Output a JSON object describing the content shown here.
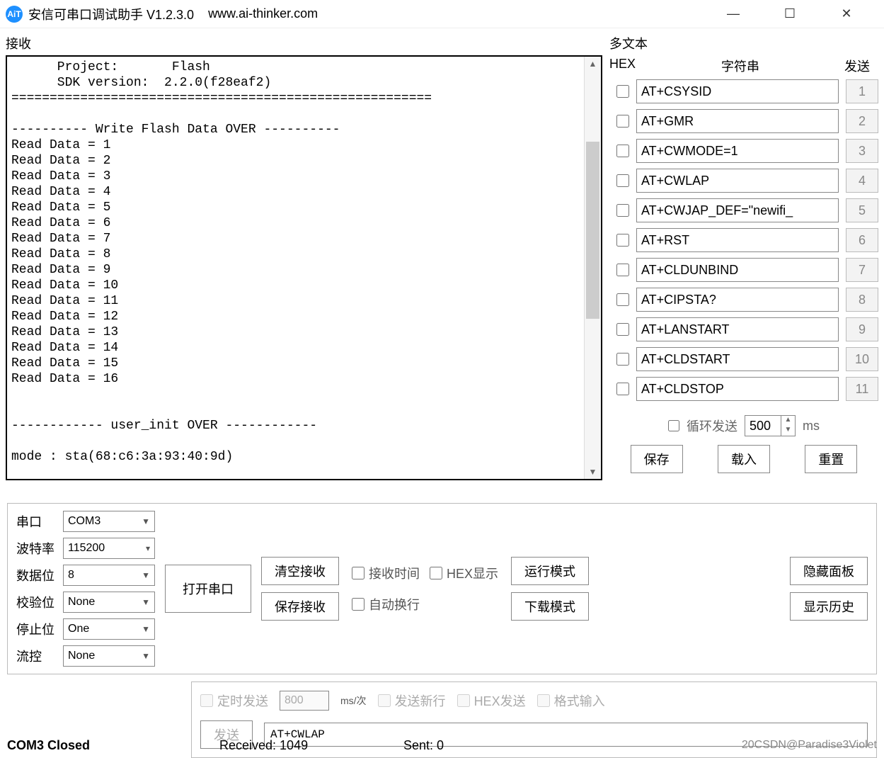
{
  "title_bar": {
    "app_icon_text": "AiT",
    "title": "安信可串口调试助手 V1.2.3.0",
    "url": "www.ai-thinker.com"
  },
  "receive": {
    "label": "接收",
    "content": "      Project:       Flash\n      SDK version:  2.2.0(f28eaf2)\n=======================================================\n\n---------- Write Flash Data OVER ----------\nRead Data = 1\nRead Data = 2\nRead Data = 3\nRead Data = 4\nRead Data = 5\nRead Data = 6\nRead Data = 7\nRead Data = 8\nRead Data = 9\nRead Data = 10\nRead Data = 11\nRead Data = 12\nRead Data = 13\nRead Data = 14\nRead Data = 15\nRead Data = 16\n\n\n------------ user_init OVER ------------\n\nmode : sta(68:c6:3a:93:40:9d)"
  },
  "multi": {
    "label": "多文本",
    "header_hex": "HEX",
    "header_str": "字符串",
    "header_send": "发送",
    "rows": [
      {
        "cmd": "AT+CSYSID",
        "num": "1"
      },
      {
        "cmd": "AT+GMR",
        "num": "2"
      },
      {
        "cmd": "AT+CWMODE=1",
        "num": "3"
      },
      {
        "cmd": "AT+CWLAP",
        "num": "4"
      },
      {
        "cmd": "AT+CWJAP_DEF=\"newifi_",
        "num": "5"
      },
      {
        "cmd": "AT+RST",
        "num": "6"
      },
      {
        "cmd": "AT+CLDUNBIND",
        "num": "7"
      },
      {
        "cmd": "AT+CIPSTA?",
        "num": "8"
      },
      {
        "cmd": "AT+LANSTART",
        "num": "9"
      },
      {
        "cmd": "AT+CLDSTART",
        "num": "10"
      },
      {
        "cmd": "AT+CLDSTOP",
        "num": "11"
      }
    ],
    "loop_label": "循环发送",
    "loop_value": "500",
    "loop_unit": "ms",
    "btn_save": "保存",
    "btn_load": "载入",
    "btn_reset": "重置"
  },
  "serial": {
    "port_label": "串口",
    "port_value": "COM3",
    "baud_label": "波特率",
    "baud_value": "115200",
    "data_label": "数据位",
    "data_value": "8",
    "parity_label": "校验位",
    "parity_value": "None",
    "stop_label": "停止位",
    "stop_value": "One",
    "flow_label": "流控",
    "flow_value": "None"
  },
  "controls": {
    "open_port": "打开串口",
    "clear_recv": "清空接收",
    "save_recv": "保存接收",
    "recv_time": "接收时间",
    "hex_disp": "HEX显示",
    "auto_wrap": "自动换行",
    "run_mode": "运行模式",
    "download_mode": "下载模式",
    "hide_panel": "隐藏面板",
    "show_history": "显示历史"
  },
  "send_panel": {
    "timed_send": "定时发送",
    "interval_value": "800",
    "interval_unit": "ms/次",
    "send_newline": "发送新行",
    "hex_send": "HEX发送",
    "format_input": "格式输入",
    "send_btn": "发送",
    "send_value": "AT+CWLAP"
  },
  "status": {
    "port_status": "COM3 Closed",
    "received": "Received: 1049",
    "sent": "Sent: 0",
    "watermark": "20CSDN@Paradise3Violet"
  }
}
